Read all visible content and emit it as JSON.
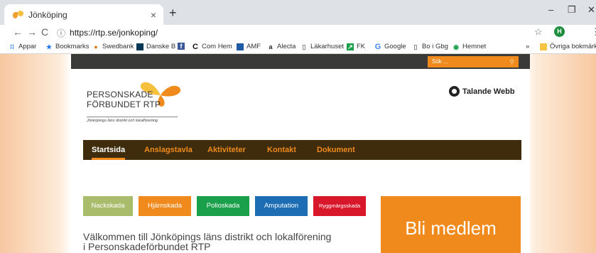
{
  "browser": {
    "tab_title": "Jönköping",
    "tab_close": "×",
    "new_tab": "+",
    "window_controls": [
      "–",
      "❐",
      "✕"
    ],
    "url": "https://rtp.se/jonkoping/",
    "avatar_letter": "H",
    "bookmarks": [
      "Appar",
      "Bookmarks",
      "Swedbank",
      "Danske B",
      "C",
      "Com Hem",
      "AMF",
      "Alecta",
      "Läkarhuset",
      "FK",
      "Google",
      "Bo i Gbg",
      "Hemnet"
    ],
    "bookmarks_overflow": "»",
    "other_bookmarks": "Övriga bokmärken"
  },
  "site": {
    "search_placeholder": "Sök ...",
    "logo_line1": "PERSONSKADE",
    "logo_line2": "FÖRBUNDET RTP",
    "logo_sub": "Jönköpings läns distrikt och lokalförening",
    "talande_webb": "Talande Webb",
    "nav": [
      "Startsida",
      "Anslagstavla",
      "Aktiviteter",
      "Kontakt",
      "Dokument"
    ],
    "categories": [
      {
        "label": "Nackskada",
        "color": "#a8bc6c"
      },
      {
        "label": "Hjärnskada",
        "color": "#f08a1c"
      },
      {
        "label": "Polioskada",
        "color": "#1aa04a"
      },
      {
        "label": "Amputation",
        "color": "#1d6db5"
      },
      {
        "label": "Ryggmärgsskada",
        "color": "#d9172a"
      }
    ],
    "welcome_line1": "Välkommen till Jönköpings läns distrikt och lokalförening",
    "welcome_line2": "i Personskadeförbundet RTP",
    "cta": "Bli medlem"
  },
  "colors": {
    "accent": "#f08a1c",
    "nav_bg": "#3e2c0c",
    "topbar": "#3a3a38"
  }
}
